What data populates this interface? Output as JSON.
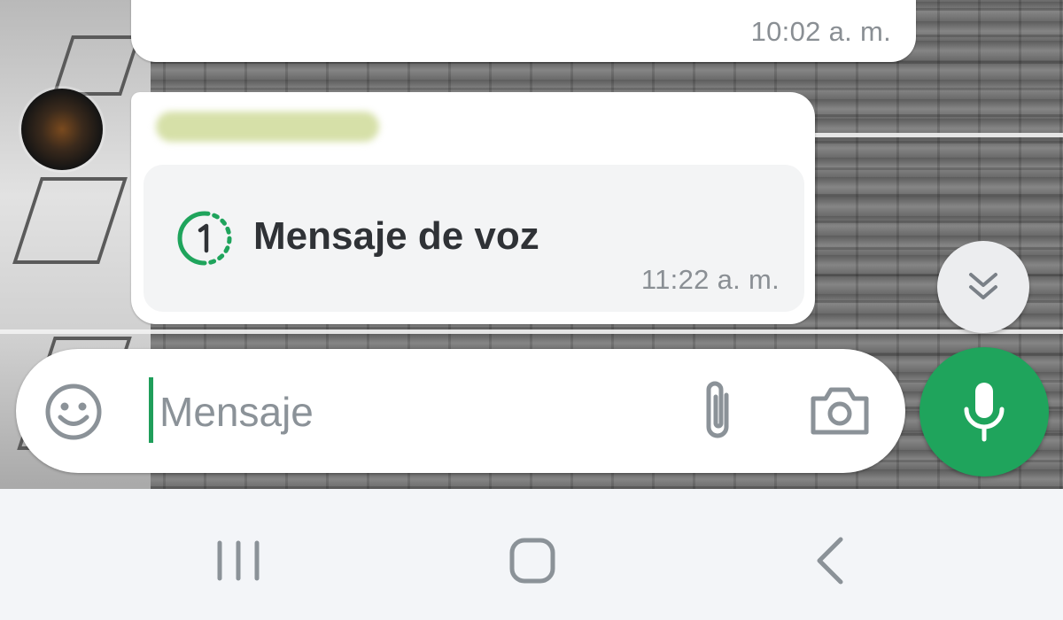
{
  "conversation": {
    "previous_message": {
      "time": "10:02 a. m."
    },
    "voice_message": {
      "label": "Mensaje de voz",
      "time": "11:22 a. m.",
      "icon": "view-once-1-icon"
    }
  },
  "scroll_button": {
    "icon": "double-chevron-down-icon"
  },
  "composer": {
    "placeholder": "Mensaje",
    "value": "",
    "emoji_icon": "smiley-icon",
    "attach_icon": "paperclip-icon",
    "camera_icon": "camera-icon",
    "send_icon": "microphone-icon"
  },
  "navbar": {
    "recents_icon": "recents-icon",
    "home_icon": "home-icon",
    "back_icon": "back-icon"
  },
  "colors": {
    "accent": "#1fa45c",
    "bubble": "#ffffff",
    "voice_card": "#f3f4f5",
    "timestamp": "#8a8f94",
    "icon_gray": "#8b9298"
  }
}
